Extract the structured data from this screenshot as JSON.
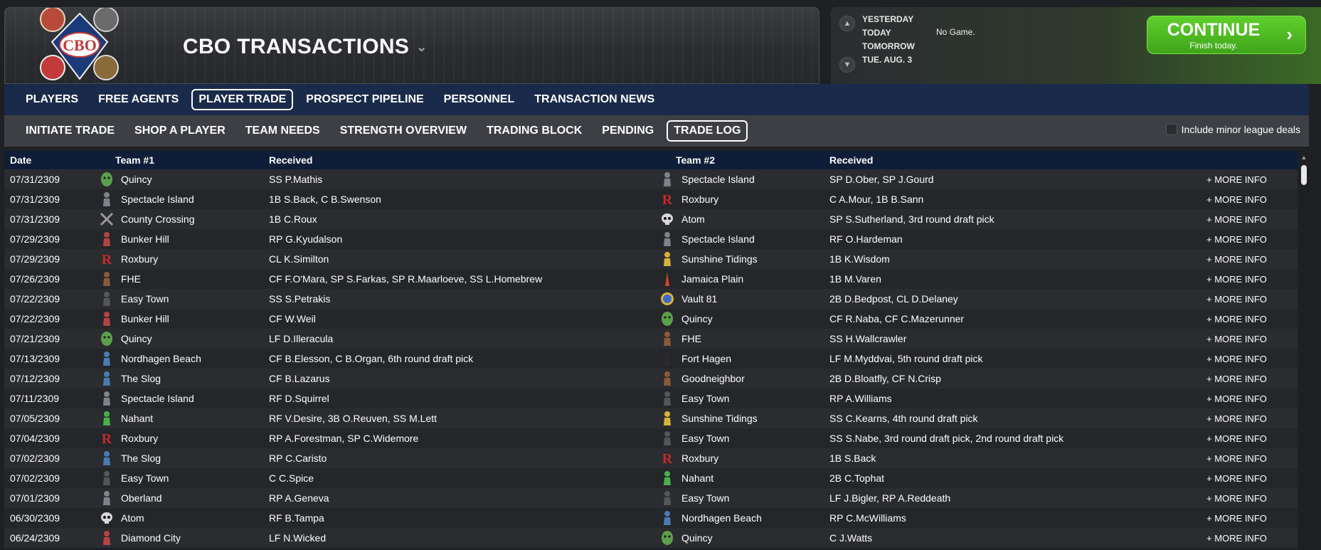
{
  "header": {
    "title": "CBO TRANSACTIONS",
    "logo_text": "CBO"
  },
  "dates": {
    "items": [
      "YESTERDAY",
      "TODAY",
      "TOMORROW",
      "TUE. AUG. 3"
    ],
    "status": "No Game."
  },
  "continue": {
    "label": "CONTINUE",
    "sub": "Finish today."
  },
  "nav1": [
    "PLAYERS",
    "FREE AGENTS",
    "PLAYER TRADE",
    "PROSPECT PIPELINE",
    "PERSONNEL",
    "TRANSACTION NEWS"
  ],
  "nav2": [
    "INITIATE TRADE",
    "SHOP A PLAYER",
    "TEAM NEEDS",
    "STRENGTH OVERVIEW",
    "TRADING BLOCK",
    "PENDING",
    "TRADE LOG"
  ],
  "minor_label": "Include minor league deals",
  "table": {
    "headers": [
      "Date",
      "Team #1",
      "Received",
      "Team #2",
      "Received"
    ],
    "more_label": "+ MORE INFO",
    "rows": [
      {
        "date": "07/31/2309",
        "team1": "Quincy",
        "rec1": "SS P.Mathis",
        "team2": "Spectacle Island",
        "rec2": "SP D.Ober, SP J.Gourd",
        "icon1": "green-ghoul",
        "icon2": "gray-figure"
      },
      {
        "date": "07/31/2309",
        "team1": "Spectacle Island",
        "rec1": "1B S.Back, C B.Swenson",
        "team2": "Roxbury",
        "rec2": "C A.Mour, 1B B.Sann",
        "icon1": "gray-figure",
        "icon2": "red-r"
      },
      {
        "date": "07/31/2309",
        "team1": "County Crossing",
        "rec1": "1B C.Roux",
        "team2": "Atom",
        "rec2": "SP S.Sutherland, 3rd round draft pick",
        "icon1": "crossed-bats",
        "icon2": "atom-skull"
      },
      {
        "date": "07/29/2309",
        "team1": "Bunker Hill",
        "rec1": "RP G.Kyudalson",
        "team2": "Spectacle Island",
        "rec2": "RF O.Hardeman",
        "icon1": "red-figure",
        "icon2": "gray-figure"
      },
      {
        "date": "07/29/2309",
        "team1": "Roxbury",
        "rec1": "CL K.Similton",
        "team2": "Sunshine Tidings",
        "rec2": "1B K.Wisdom",
        "icon1": "red-r",
        "icon2": "yellow-figure"
      },
      {
        "date": "07/26/2309",
        "team1": "FHE",
        "rec1": "CF F.O'Mara, SP S.Farkas, SP R.Maarloeve, SS L.Homebrew",
        "team2": "Jamaica Plain",
        "rec2": "1B M.Varen",
        "icon1": "brown-figure",
        "icon2": "red-tower"
      },
      {
        "date": "07/22/2309",
        "team1": "Easy Town",
        "rec1": "SS S.Petrakis",
        "team2": "Vault 81",
        "rec2": "2B D.Bedpost, CL D.Delaney",
        "icon1": "dark-figure",
        "icon2": "vault-badge"
      },
      {
        "date": "07/22/2309",
        "team1": "Bunker Hill",
        "rec1": "CF W.Weil",
        "team2": "Quincy",
        "rec2": "CF R.Naba, CF C.Mazerunner",
        "icon1": "red-figure",
        "icon2": "green-ghoul"
      },
      {
        "date": "07/21/2309",
        "team1": "Quincy",
        "rec1": "LF D.Illeracula",
        "team2": "FHE",
        "rec2": "SS H.Wallcrawler",
        "icon1": "green-ghoul",
        "icon2": "brown-figure"
      },
      {
        "date": "07/13/2309",
        "team1": "Nordhagen Beach",
        "rec1": "CF B.Elesson, C B.Organ, 6th round draft pick",
        "team2": "Fort Hagen",
        "rec2": "LF M.Myddvai, 5th round draft pick",
        "icon1": "blue-figure",
        "icon2": "black-figure"
      },
      {
        "date": "07/12/2309",
        "team1": "The Slog",
        "rec1": "CF B.Lazarus",
        "team2": "Goodneighbor",
        "rec2": "2B D.Bloatfly, CF N.Crisp",
        "icon1": "blue-figure",
        "icon2": "brown-figure"
      },
      {
        "date": "07/11/2309",
        "team1": "Spectacle Island",
        "rec1": "RF D.Squirrel",
        "team2": "Easy Town",
        "rec2": "RP A.Williams",
        "icon1": "gray-figure",
        "icon2": "dark-figure"
      },
      {
        "date": "07/05/2309",
        "team1": "Nahant",
        "rec1": "RF V.Desire, 3B O.Reuven, SS M.Lett",
        "team2": "Sunshine Tidings",
        "rec2": "SS C.Kearns, 4th round draft pick",
        "icon1": "green-figure",
        "icon2": "yellow-figure"
      },
      {
        "date": "07/04/2309",
        "team1": "Roxbury",
        "rec1": "RP A.Forestman, SP C.Widemore",
        "team2": "Easy Town",
        "rec2": "SS S.Nabe, 3rd round draft pick, 2nd round draft pick",
        "icon1": "red-r",
        "icon2": "dark-figure"
      },
      {
        "date": "07/02/2309",
        "team1": "The Slog",
        "rec1": "RP C.Caristo",
        "team2": "Roxbury",
        "rec2": "1B S.Back",
        "icon1": "blue-figure",
        "icon2": "red-r"
      },
      {
        "date": "07/02/2309",
        "team1": "Easy Town",
        "rec1": "C C.Spice",
        "team2": "Nahant",
        "rec2": "2B C.Tophat",
        "icon1": "dark-figure",
        "icon2": "green-figure"
      },
      {
        "date": "07/01/2309",
        "team1": "Oberland",
        "rec1": "RP A.Geneva",
        "team2": "Easy Town",
        "rec2": "LF J.Bigler, RP A.Reddeath",
        "icon1": "gray-figure",
        "icon2": "dark-figure"
      },
      {
        "date": "06/30/2309",
        "team1": "Atom",
        "rec1": "RF B.Tampa",
        "team2": "Nordhagen Beach",
        "rec2": "RP C.McWilliams",
        "icon1": "atom-skull",
        "icon2": "blue-figure"
      },
      {
        "date": "06/24/2309",
        "team1": "Diamond City",
        "rec1": "LF N.Wicked",
        "team2": "Quincy",
        "rec2": "C J.Watts",
        "icon1": "red-figure",
        "icon2": "green-ghoul"
      }
    ]
  }
}
